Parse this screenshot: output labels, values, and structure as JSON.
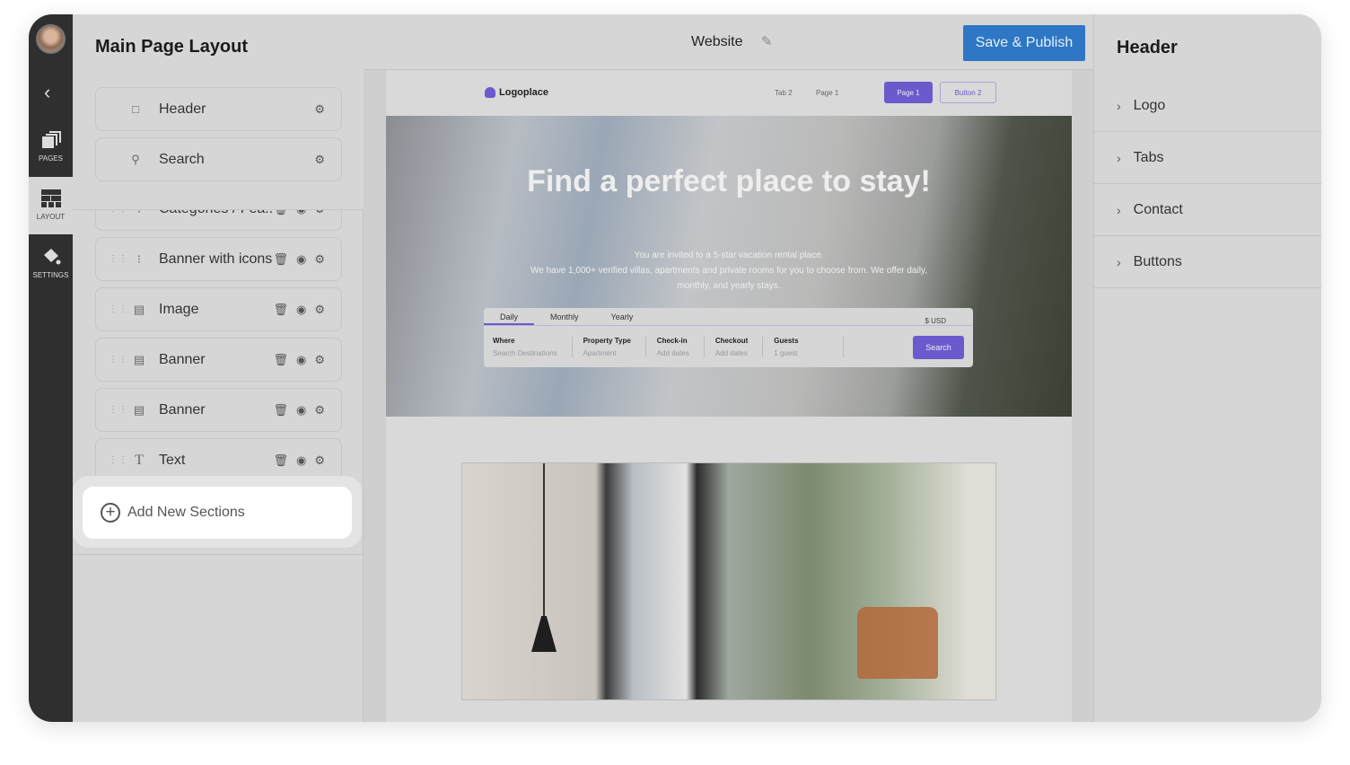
{
  "rail": {
    "items": [
      {
        "label": "PAGES",
        "icon": "pages-icon"
      },
      {
        "label": "LAYOUT",
        "icon": "layout-icon"
      },
      {
        "label": "SETTINGS",
        "icon": "paint-bucket-icon"
      }
    ],
    "active": "LAYOUT"
  },
  "left": {
    "title": "Main Page Layout",
    "fixed": [
      {
        "label": "Header",
        "icon": "header-icon"
      },
      {
        "label": "Search",
        "icon": "search-icon"
      }
    ],
    "sections": [
      {
        "label": "Categories / Fea...",
        "icon": "grid-icon"
      },
      {
        "label": "Banner with icons",
        "icon": "banner-icon"
      },
      {
        "label": "Image",
        "icon": "banner-icon"
      },
      {
        "label": "Banner",
        "icon": "banner-icon"
      },
      {
        "label": "Banner",
        "icon": "banner-icon"
      },
      {
        "label": "Text",
        "icon": "text-icon"
      }
    ],
    "add_label": "Add New Sections"
  },
  "topbar": {
    "title": "Website",
    "save_label": "Save & Publish"
  },
  "site": {
    "logo": "Logoplace",
    "tabs": [
      "Tab 2",
      "Page 1"
    ],
    "btn_primary": "Page 1",
    "btn_secondary": "Button 2",
    "hero_title": "Find a perfect place to stay!",
    "hero_line1": "You are invited to a 5-star vacation rental place.",
    "hero_line2": "We have 1,000+ verified villas, apartments and private rooms for you to choose from. We offer daily, monthly, and yearly stays.",
    "search": {
      "tabs": [
        "Daily",
        "Monthly",
        "Yearly"
      ],
      "currency": "$ USD",
      "fields": [
        {
          "label": "Where",
          "value": "Search Destinations"
        },
        {
          "label": "Property Type",
          "value": "Apartment"
        },
        {
          "label": "Check-in",
          "value": "Add dates"
        },
        {
          "label": "Checkout",
          "value": "Add dates"
        },
        {
          "label": "Guests",
          "value": "1 guest"
        }
      ],
      "button": "Search"
    }
  },
  "right": {
    "title": "Header",
    "items": [
      "Logo",
      "Tabs",
      "Contact",
      "Buttons"
    ]
  },
  "colors": {
    "accent": "#6a5acd",
    "publish": "#2d77c4",
    "rail": "#2f2f2f"
  }
}
